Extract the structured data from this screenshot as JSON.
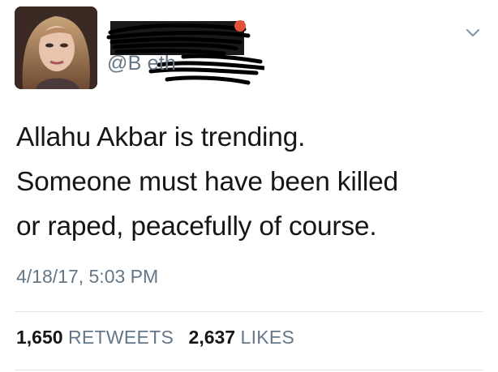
{
  "user": {
    "handle_visible": "@B eth",
    "name_redacted": true,
    "icon": "profile-avatar"
  },
  "tweet": {
    "lines": [
      "Allahu Akbar is trending.",
      "Someone must have been killed",
      "or raped, peacefully of course."
    ],
    "timestamp": "4/18/17, 5:03 PM"
  },
  "stats": {
    "retweets_count": "1,650",
    "retweets_label": "RETWEETS",
    "likes_count": "2,637",
    "likes_label": "LIKES"
  },
  "menu": {
    "icon": "chevron-down-icon"
  }
}
